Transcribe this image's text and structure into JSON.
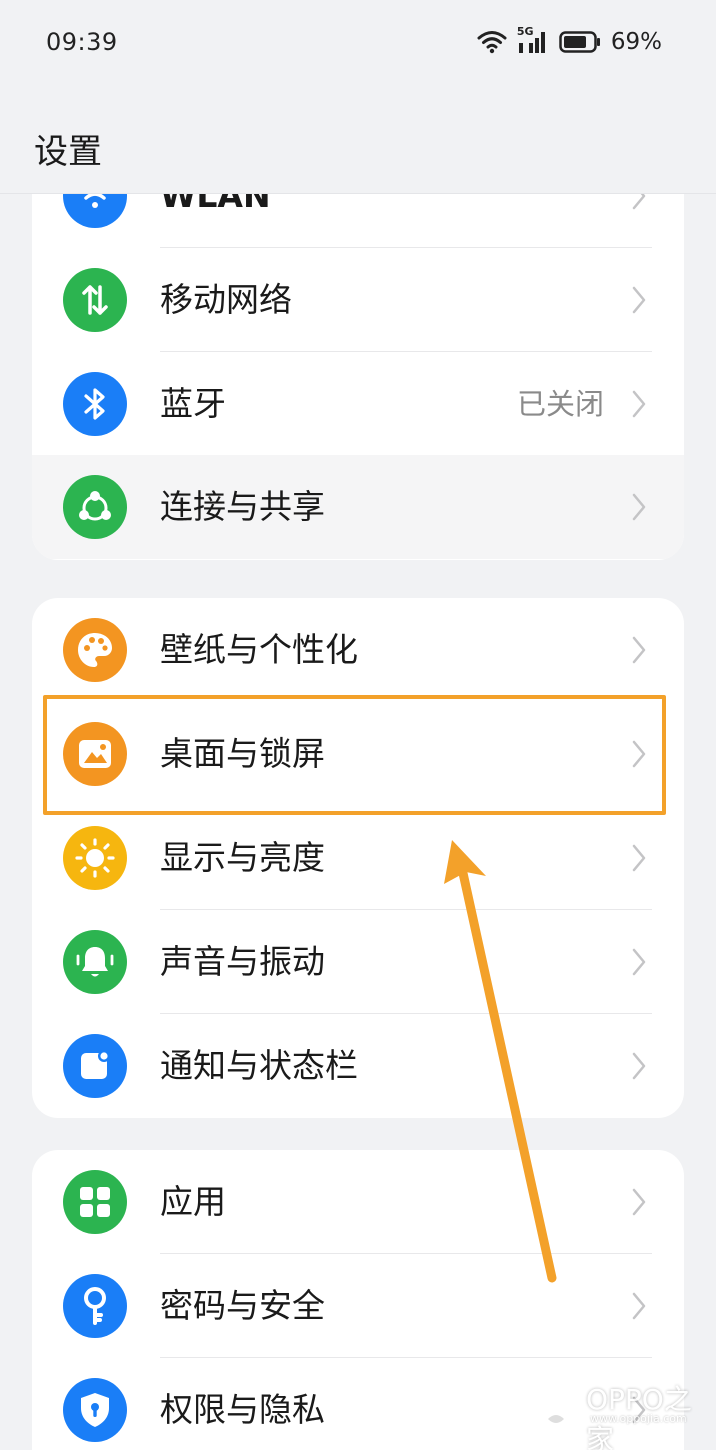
{
  "status_bar": {
    "time": "09:39",
    "network": "5G",
    "battery": "69%"
  },
  "header": {
    "title": "设置"
  },
  "groups": [
    {
      "items": [
        {
          "label": "WLAN",
          "value": "",
          "icon": "wifi-icon",
          "color": "#1a7ef7"
        },
        {
          "label": "移动网络",
          "value": "",
          "icon": "mobile-data-icon",
          "color": "#2cb450"
        },
        {
          "label": "蓝牙",
          "value": "已关闭",
          "icon": "bluetooth-icon",
          "color": "#1a7ef7"
        },
        {
          "label": "连接与共享",
          "value": "",
          "icon": "share-icon",
          "color": "#2cb450"
        }
      ]
    },
    {
      "items": [
        {
          "label": "壁纸与个性化",
          "value": "",
          "icon": "palette-icon",
          "color": "#f39521"
        },
        {
          "label": "桌面与锁屏",
          "value": "",
          "icon": "picture-icon",
          "color": "#f39521"
        },
        {
          "label": "显示与亮度",
          "value": "",
          "icon": "sun-icon",
          "color": "#f6b60f"
        },
        {
          "label": "声音与振动",
          "value": "",
          "icon": "bell-icon",
          "color": "#2cb450"
        },
        {
          "label": "通知与状态栏",
          "value": "",
          "icon": "notification-icon",
          "color": "#1a7ef7"
        }
      ]
    },
    {
      "items": [
        {
          "label": "应用",
          "value": "",
          "icon": "apps-grid-icon",
          "color": "#2cb450"
        },
        {
          "label": "密码与安全",
          "value": "",
          "icon": "key-icon",
          "color": "#1a7ef7"
        },
        {
          "label": "权限与隐私",
          "value": "",
          "icon": "shield-lock-icon",
          "color": "#1a7ef7"
        }
      ]
    }
  ],
  "watermark": {
    "text": "OPPO之家",
    "sub": "www.oppojia.com"
  },
  "colors": {
    "highlight": "#f3a12a",
    "background": "#f1f2f4"
  }
}
